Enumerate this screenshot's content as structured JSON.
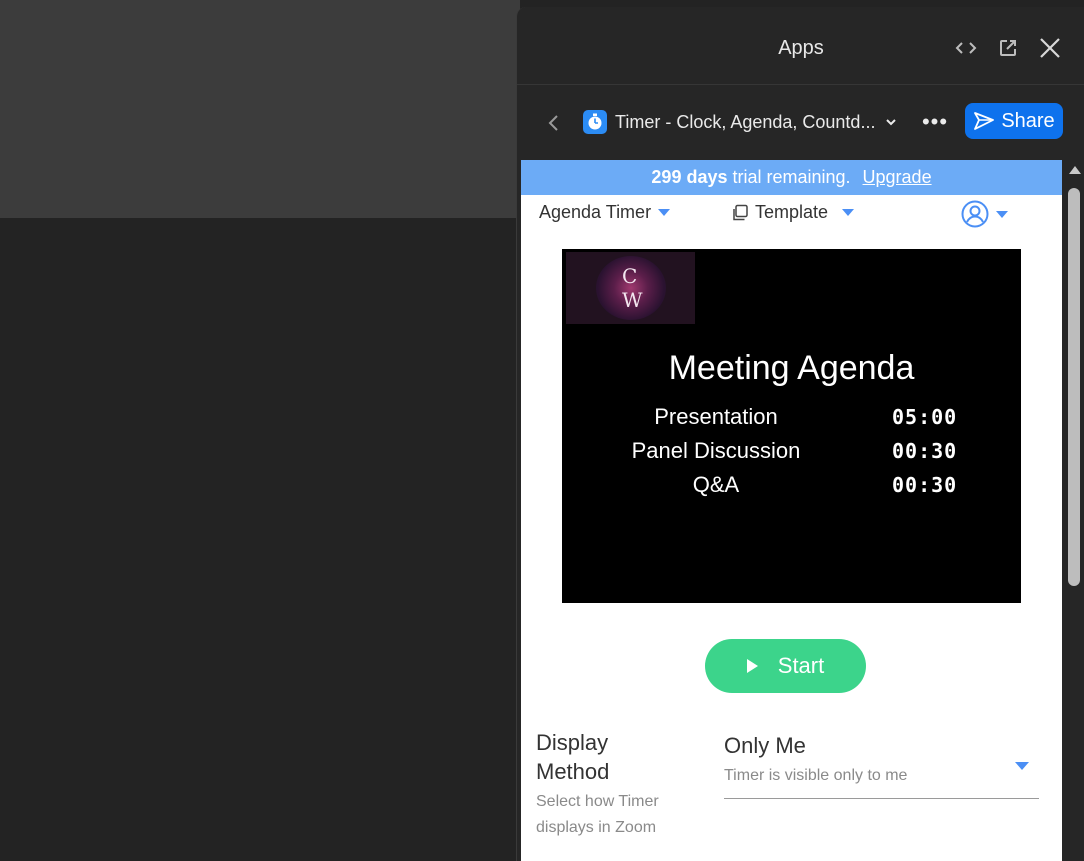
{
  "panel": {
    "title": "Apps"
  },
  "nav": {
    "app_name": "Timer - Clock, Agenda, Countd...",
    "more_label": "•••",
    "share_label": "Share"
  },
  "trial": {
    "days": "299 days",
    "text": "trial remaining.",
    "upgrade": "Upgrade"
  },
  "toolbar": {
    "mode": "Agenda Timer",
    "template": "Template"
  },
  "preview": {
    "logo_letters": [
      "C",
      "W"
    ],
    "title": "Meeting Agenda",
    "items": [
      {
        "name": "Presentation",
        "time": "05:00"
      },
      {
        "name": "Panel Discussion",
        "time": "00:30"
      },
      {
        "name": "Q&A",
        "time": "00:30"
      }
    ]
  },
  "start_label": "Start",
  "display_method": {
    "label": "Display Method",
    "hint": "Select how Timer displays in Zoom",
    "value": "Only Me",
    "sub": "Timer is visible only to me"
  },
  "colors": {
    "share": "#0e72ed",
    "trial_banner": "#6cabf6",
    "start": "#3cd48b",
    "caret": "#4b8ff5"
  }
}
